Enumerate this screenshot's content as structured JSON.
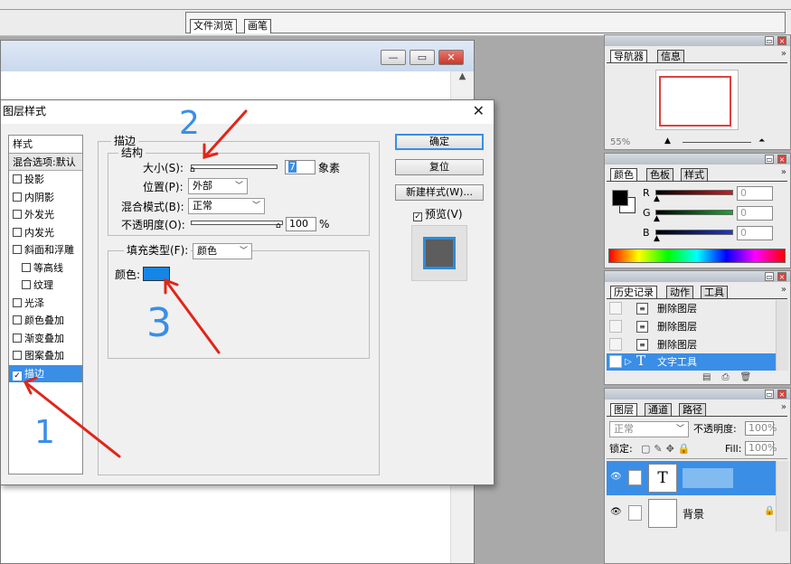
{
  "top_tabs": [
    "文件浏览",
    "画笔"
  ],
  "doc_window": {
    "min": "—",
    "max": "▭",
    "close": "✕"
  },
  "dialog": {
    "title": "图层样式",
    "close": "✕",
    "styles": [
      {
        "label": "样式",
        "kind": "header"
      },
      {
        "label": "混合选项:默认",
        "kind": "blend"
      },
      {
        "label": "投影",
        "checked": false
      },
      {
        "label": "内阴影",
        "checked": false
      },
      {
        "label": "外发光",
        "checked": false
      },
      {
        "label": "内发光",
        "checked": false
      },
      {
        "label": "斜面和浮雕",
        "checked": false
      },
      {
        "label": "等高线",
        "checked": false,
        "sub": true
      },
      {
        "label": "纹理",
        "checked": false,
        "sub": true
      },
      {
        "label": "光泽",
        "checked": false
      },
      {
        "label": "颜色叠加",
        "checked": false
      },
      {
        "label": "渐变叠加",
        "checked": false
      },
      {
        "label": "图案叠加",
        "checked": false
      },
      {
        "label": "描边",
        "checked": true,
        "selected": true
      }
    ],
    "stroke": {
      "group_title": "描边",
      "struct_title": "结构",
      "size_label": "大小(S):",
      "size_value": "7",
      "size_unit": "象素",
      "position_label": "位置(P):",
      "position_value": "外部",
      "blend_label": "混合模式(B):",
      "blend_value": "正常",
      "opacity_label": "不透明度(O):",
      "opacity_value": "100",
      "opacity_unit": "%",
      "fill_type_label": "填充类型(F):",
      "fill_type_value": "颜色",
      "color_label": "颜色:",
      "color_value": "#1585e6"
    },
    "buttons": {
      "ok": "确定",
      "reset": "复位",
      "new_style": "新建样式(W)...",
      "preview": "预览(V)"
    },
    "preview_checked": true
  },
  "navigator_panel": {
    "tabs": [
      "导航器",
      "信息"
    ],
    "zoom": "55%"
  },
  "color_panel": {
    "tabs": [
      "颜色",
      "色板",
      "样式"
    ],
    "channels": [
      {
        "name": "R",
        "value": "0",
        "color": "#d11a1a"
      },
      {
        "name": "G",
        "value": "0",
        "color": "#18a82c"
      },
      {
        "name": "B",
        "value": "0",
        "color": "#1f37c9"
      }
    ]
  },
  "history_panel": {
    "tabs": [
      "历史记录",
      "动作",
      "工具"
    ],
    "items": [
      {
        "label": "删除图层",
        "icon": "document-icon"
      },
      {
        "label": "删除图层",
        "icon": "document-icon"
      },
      {
        "label": "删除图层",
        "icon": "document-icon"
      },
      {
        "label": "文字工具",
        "icon": "text-tool-icon",
        "selected": true
      }
    ]
  },
  "layers_panel": {
    "tabs": [
      "图层",
      "通道",
      "路径"
    ],
    "blend_mode": "正常",
    "opacity_label": "不透明度:",
    "opacity_value": "100%",
    "lock_label": "锁定:",
    "fill_label": "Fill:",
    "fill_value": "100%",
    "layers": [
      {
        "thumb": "T",
        "name": "",
        "selected": true
      },
      {
        "thumb": "",
        "name": "背景",
        "locked": true
      }
    ]
  },
  "annotations": [
    "1",
    "2",
    "3"
  ]
}
